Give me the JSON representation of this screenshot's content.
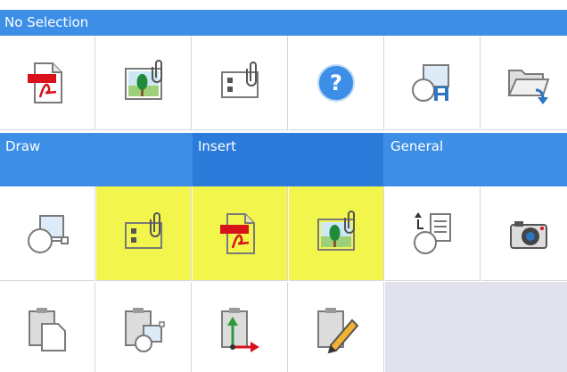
{
  "title_bar": {
    "label": "No Selection"
  },
  "sections": {
    "draw": "Draw",
    "insert": "Insert",
    "general": "General"
  },
  "tiles_top": [
    {
      "icon": "pdf-document-icon"
    },
    {
      "icon": "attached-image-icon"
    },
    {
      "icon": "attached-block-icon"
    },
    {
      "icon": "help-icon"
    },
    {
      "icon": "save-shape-icon"
    },
    {
      "icon": "open-folder-icon"
    }
  ],
  "tiles_middle": [
    {
      "icon": "draw-shape-icon"
    },
    {
      "icon": "attached-block-icon",
      "highlighted": true
    },
    {
      "icon": "pdf-document-icon",
      "highlighted": true
    },
    {
      "icon": "attached-image-icon",
      "highlighted": true
    },
    {
      "icon": "import-list-icon"
    },
    {
      "icon": "camera-icon"
    }
  ],
  "tiles_bottom": [
    {
      "icon": "paste-icon"
    },
    {
      "icon": "paste-shape-icon"
    },
    {
      "icon": "paste-coordinates-icon"
    },
    {
      "icon": "clipboard-edit-icon"
    }
  ],
  "colors": {
    "header_blue": "#3c8ee6",
    "header_active": "#2b7bdb",
    "highlight_yellow": "#f2f54c",
    "empty_cell": "#e2e2ee",
    "pdf_red": "#d8121b",
    "help_blue": "#3c8ee6"
  }
}
